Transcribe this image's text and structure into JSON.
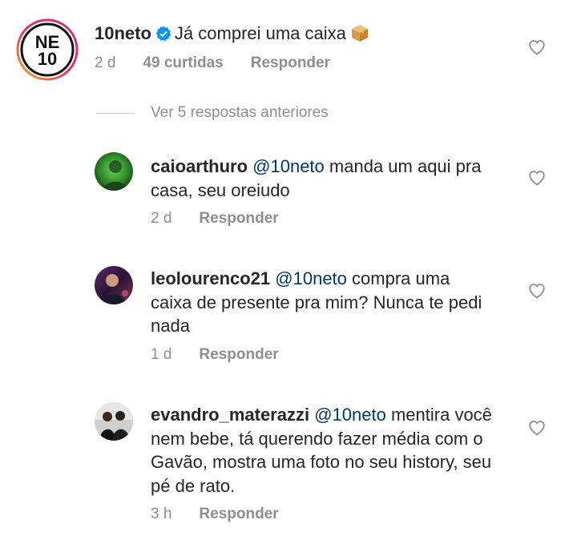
{
  "main_comment": {
    "username": "10neto",
    "text": "Já comprei uma caixa",
    "emoji": "package-emoji",
    "time": "2 d",
    "likes": "49 curtidas",
    "reply_label": "Responder",
    "avatar_text_top": "NE",
    "avatar_text_bottom": "10"
  },
  "view_previous": "Ver 5 respostas anteriores",
  "replies": [
    {
      "username": "caioarthuro",
      "mention": "@10neto",
      "text": "manda um aqui pra casa, seu oreiudo",
      "time": "2 d",
      "reply_label": "Responder"
    },
    {
      "username": "leolourenco21",
      "mention": "@10neto",
      "text": "compra uma caixa de presente pra mim? Nunca te pedi nada",
      "time": "1 d",
      "reply_label": "Responder"
    },
    {
      "username": "evandro_materazzi",
      "mention": "@10neto",
      "text": "mentira você nem bebe, tá querendo fazer média com o Gavão, mostra uma foto no seu history, seu pé de rato.",
      "time": "3 h",
      "reply_label": "Responder"
    }
  ],
  "colors": {
    "text": "#262626",
    "secondary": "#8e8e8e",
    "mention": "#00376b",
    "verified": "#0095f6",
    "story_ring_start": "#f5a623",
    "story_ring_end": "#d62976"
  }
}
